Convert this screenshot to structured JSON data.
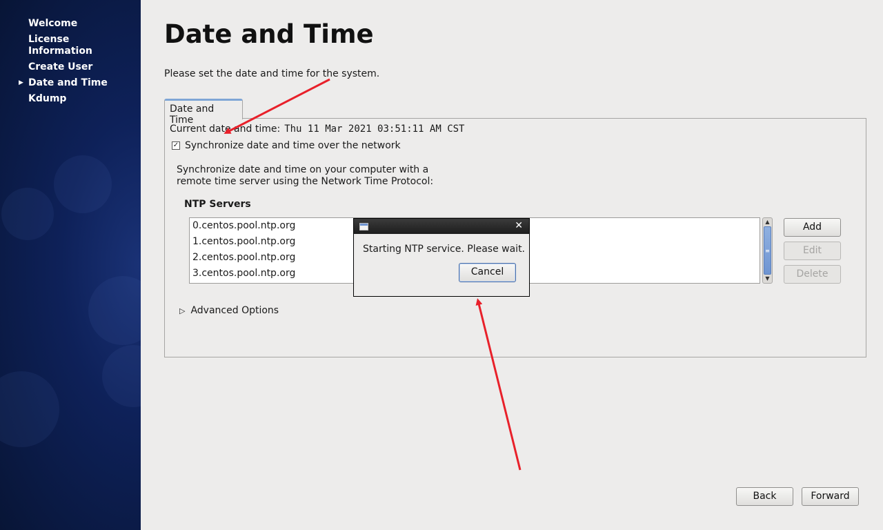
{
  "sidebar": {
    "items": [
      {
        "label": "Welcome",
        "current": false
      },
      {
        "label": "License Information",
        "current": false
      },
      {
        "label": "Create User",
        "current": false
      },
      {
        "label": "Date and Time",
        "current": true
      },
      {
        "label": "Kdump",
        "current": false
      }
    ]
  },
  "main": {
    "title": "Date and Time",
    "subtitle": "Please set the date and time for the system.",
    "tab_label": "Date and Time",
    "current_label": "Current date and time:",
    "current_value": "Thu 11 Mar 2021 03:51:11 AM CST",
    "sync_label": "Synchronize date and time over the network",
    "sync_checked": true,
    "description_line1": "Synchronize date and time on your computer with a",
    "description_line2": "remote time server using the Network Time Protocol:",
    "ntp_title": "NTP Servers",
    "ntp_servers": [
      "0.centos.pool.ntp.org",
      "1.centos.pool.ntp.org",
      "2.centos.pool.ntp.org",
      "3.centos.pool.ntp.org"
    ],
    "add_label": "Add",
    "edit_label": "Edit",
    "delete_label": "Delete",
    "advanced_label": "Advanced Options"
  },
  "dialog": {
    "message": "Starting NTP service. Please wait.",
    "cancel_label": "Cancel"
  },
  "footer": {
    "back_label": "Back",
    "forward_label": "Forward"
  },
  "colors": {
    "annotation_arrow": "#e8202a",
    "sidebar_bg": "#0e2159"
  }
}
